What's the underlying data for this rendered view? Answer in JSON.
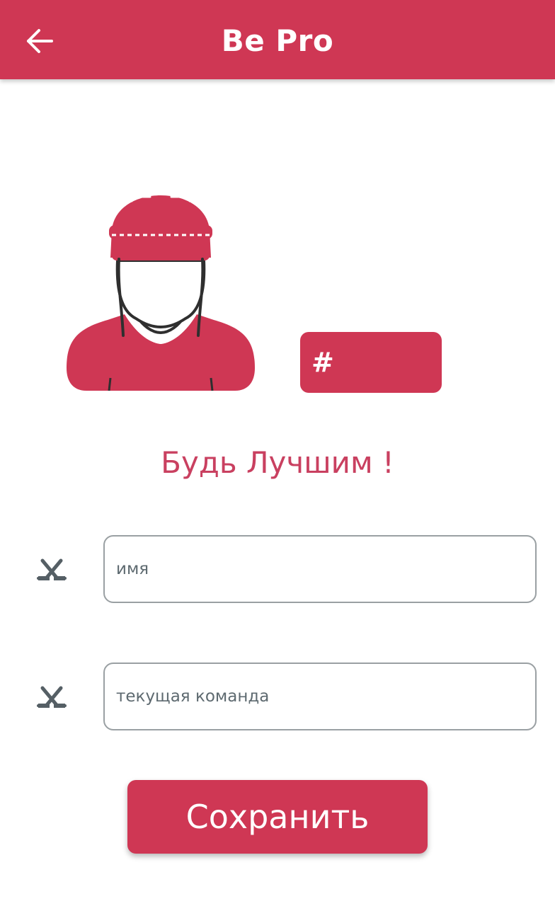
{
  "app": {
    "title": "Be Pro"
  },
  "header": {
    "back_icon": "arrow-left-icon"
  },
  "profile": {
    "avatar_icon": "hockey-player-avatar",
    "number_prefix": "#",
    "number_value": ""
  },
  "slogan": "Будь Лучшим !",
  "form": {
    "name": {
      "icon": "hockey-sticks-icon",
      "placeholder": "имя",
      "value": ""
    },
    "team": {
      "icon": "hockey-sticks-icon",
      "placeholder": "текущая команда",
      "value": ""
    },
    "save_label": "Сохранить"
  },
  "colors": {
    "accent": "#cf3754",
    "slogan": "#c94060",
    "icon": "#555f65",
    "input_border": "#9aa0a3"
  }
}
